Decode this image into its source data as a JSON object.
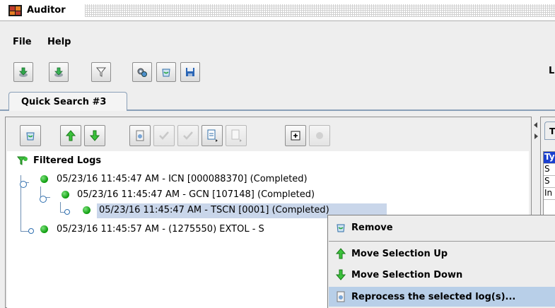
{
  "window": {
    "title": "Auditor"
  },
  "menu": {
    "items": [
      {
        "label": "File"
      },
      {
        "label": "Help"
      }
    ]
  },
  "toolbar": {
    "buttons": [
      {
        "icon": "download-icon"
      },
      {
        "icon": "download-alt-icon"
      },
      {
        "icon": "filter-icon"
      },
      {
        "icon": "settings-icon"
      },
      {
        "icon": "trash-icon"
      },
      {
        "icon": "save-icon"
      }
    ],
    "right_label": "L"
  },
  "tabs": [
    {
      "label": "Quick Search #3"
    }
  ],
  "tree": {
    "root": "Filtered Logs",
    "nodes": [
      {
        "text": "05/23/16 11:45:47 AM - ICN [000088370] (Completed)",
        "status_color": "#1aa81a"
      },
      {
        "text": "05/23/16 11:45:47 AM - GCN [107148] (Completed)",
        "status_color": "#1aa81a"
      },
      {
        "text": "05/23/16 11:45:47 AM - TSCN [0001] (Completed)",
        "status_color": "#1aa81a",
        "selected": true
      },
      {
        "text": "05/23/16 11:45:57 AM - (1275550) EXTOL - S",
        "status_color": "#1aa81a"
      }
    ]
  },
  "right_panel": {
    "tab_label": "T",
    "cells": [
      "Ty",
      "S",
      "S",
      "In"
    ]
  },
  "context_menu": {
    "items": [
      {
        "label": "Remove",
        "icon": "trash-icon"
      },
      {
        "label": "Move Selection Up",
        "icon": "arrow-up-icon"
      },
      {
        "label": "Move Selection Down",
        "icon": "arrow-down-icon"
      },
      {
        "label": "Reprocess the selected log(s)...",
        "icon": "reprocess-icon",
        "highlighted": true
      }
    ]
  },
  "colors": {
    "selection": "#c9d6ea",
    "highlight": "#b8cfe8",
    "status_ok": "#1aa81a",
    "tab_border": "#8aa0b8"
  }
}
